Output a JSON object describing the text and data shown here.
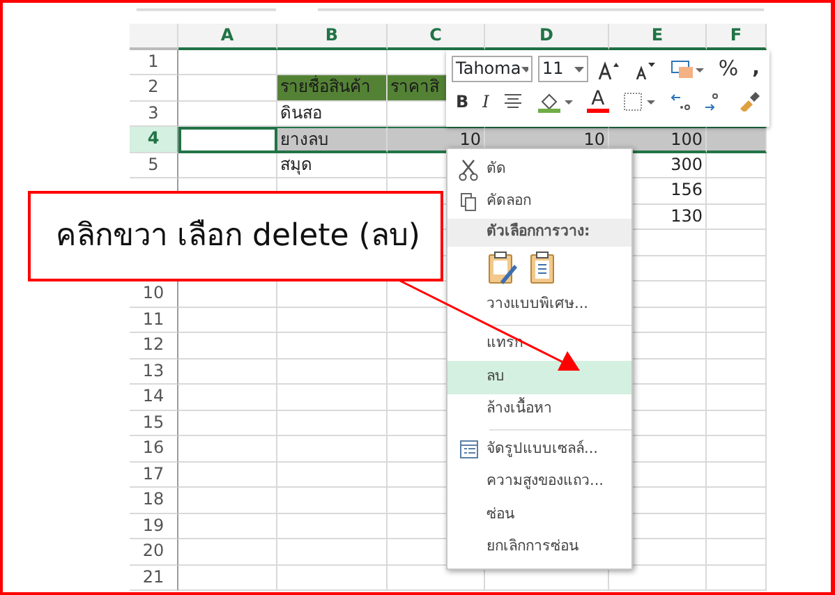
{
  "columns": [
    "A",
    "B",
    "C",
    "D",
    "E",
    "F"
  ],
  "rows": [
    {
      "number": "1",
      "selected": false,
      "cells": [
        null,
        null,
        null,
        null,
        null,
        null
      ]
    },
    {
      "number": "2",
      "selected": false,
      "cells": [
        null,
        {
          "text": "รายชื่อสินค้า",
          "kind": "header"
        },
        {
          "text": "ราคาสิ",
          "kind": "header"
        },
        null,
        null,
        null
      ]
    },
    {
      "number": "3",
      "selected": false,
      "cells": [
        null,
        {
          "text": "ดินสอ",
          "kind": "text"
        },
        null,
        null,
        null,
        null
      ]
    },
    {
      "number": "4",
      "selected": true,
      "cells": [
        null,
        {
          "text": "ยางลบ",
          "kind": "text"
        },
        {
          "text": "10",
          "kind": "number"
        },
        {
          "text": "10",
          "kind": "number"
        },
        {
          "text": "100",
          "kind": "number"
        },
        null
      ]
    },
    {
      "number": "5",
      "selected": false,
      "cells": [
        null,
        {
          "text": "สมุด",
          "kind": "text"
        },
        null,
        null,
        {
          "text": "300",
          "kind": "number"
        },
        null
      ]
    },
    {
      "selected": false,
      "cells": [
        null,
        null,
        null,
        null,
        {
          "text": "156",
          "kind": "number"
        },
        null
      ]
    },
    {
      "selected": false,
      "cells": [
        null,
        null,
        null,
        null,
        {
          "text": "130",
          "kind": "number"
        },
        null
      ]
    },
    {
      "selected": false,
      "cells": [
        null,
        null,
        null,
        null,
        null,
        null
      ]
    },
    {
      "selected": false,
      "cells": [
        null,
        null,
        null,
        null,
        null,
        null
      ]
    },
    {
      "number": "10",
      "selected": false,
      "cells": [
        null,
        null,
        null,
        null,
        null,
        null
      ]
    },
    {
      "number": "11",
      "selected": false,
      "cells": [
        null,
        null,
        null,
        null,
        null,
        null
      ]
    },
    {
      "number": "12",
      "selected": false,
      "cells": [
        null,
        null,
        null,
        null,
        null,
        null
      ]
    },
    {
      "number": "13",
      "selected": false,
      "cells": [
        null,
        null,
        null,
        null,
        null,
        null
      ]
    },
    {
      "number": "14",
      "selected": false,
      "cells": [
        null,
        null,
        null,
        null,
        null,
        null
      ]
    },
    {
      "number": "15",
      "selected": false,
      "cells": [
        null,
        null,
        null,
        null,
        null,
        null
      ]
    },
    {
      "number": "16",
      "selected": false,
      "cells": [
        null,
        null,
        null,
        null,
        null,
        null
      ]
    },
    {
      "number": "17",
      "selected": false,
      "cells": [
        null,
        null,
        null,
        null,
        null,
        null
      ]
    },
    {
      "number": "18",
      "selected": false,
      "cells": [
        null,
        null,
        null,
        null,
        null,
        null
      ]
    },
    {
      "number": "19",
      "selected": false,
      "cells": [
        null,
        null,
        null,
        null,
        null,
        null
      ]
    },
    {
      "number": "20",
      "selected": false,
      "cells": [
        null,
        null,
        null,
        null,
        null,
        null
      ]
    },
    {
      "number": "21",
      "selected": false,
      "cells": [
        null,
        null,
        null,
        null,
        null,
        null
      ]
    }
  ],
  "mini_toolbar": {
    "font": "Tahoma",
    "size": "11",
    "percent": "%",
    "comma": ",",
    "bold": "B",
    "italic": "I",
    "font_color": "A"
  },
  "context_menu": [
    {
      "kind": "cut",
      "label": "ตัด",
      "selected": false
    },
    {
      "kind": "copy",
      "label": "คัดลอก",
      "selected": false
    },
    {
      "kind": "header",
      "label": "ตัวเลือกการวาง:"
    },
    {
      "kind": "paste"
    },
    {
      "kind": "plain",
      "label": "วางแบบพิเศษ...",
      "selected": false
    },
    {
      "kind": "separator"
    },
    {
      "kind": "plain",
      "label": "แทรก",
      "selected": false
    },
    {
      "kind": "plain",
      "label": "ลบ",
      "selected": true
    },
    {
      "kind": "plain",
      "label": "ล้างเนื้อหา",
      "selected": false
    },
    {
      "kind": "separator"
    },
    {
      "kind": "format",
      "label": "จัดรูปแบบเซลล์...",
      "selected": false
    },
    {
      "kind": "plain",
      "label": "ความสูงของแถว...",
      "selected": false
    },
    {
      "kind": "plain",
      "label": "ซ่อน",
      "selected": false
    },
    {
      "kind": "plain",
      "label": "ยกเลิกการซ่อน",
      "selected": false
    }
  ],
  "callout": {
    "text": "คลิกขวา เลือก delete (ลบ)"
  }
}
